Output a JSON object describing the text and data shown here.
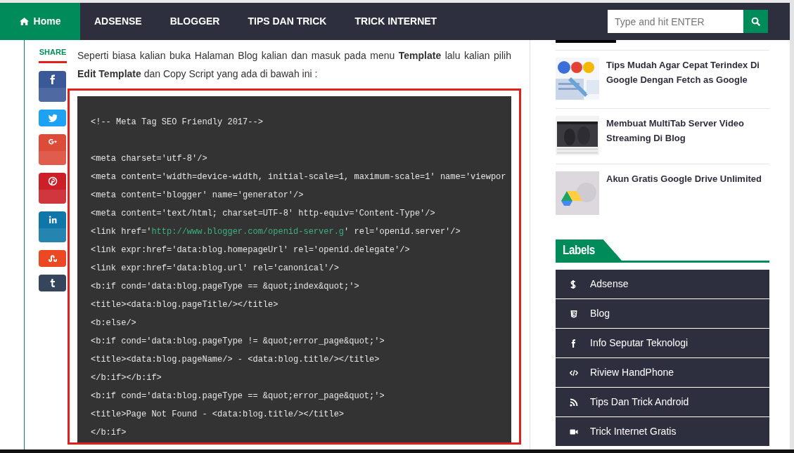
{
  "nav": {
    "items": [
      {
        "label": "Home",
        "selected": true
      },
      {
        "label": "ADSENSE",
        "selected": false
      },
      {
        "label": "BLOGGER",
        "selected": false
      },
      {
        "label": "TIPS DAN TRICK",
        "selected": false
      },
      {
        "label": "TRICK INTERNET",
        "selected": false
      }
    ],
    "search": {
      "placeholder": "Type and hit ENTER"
    }
  },
  "share": {
    "title": "SHARE",
    "buttons": [
      {
        "color": "#3b5998"
      },
      {
        "color": "#1da1f2"
      },
      {
        "color": "#dd4b39"
      },
      {
        "color": "#cb2027"
      },
      {
        "color": "#0e76a8"
      },
      {
        "color": "#eb4924"
      },
      {
        "color": "#35465c"
      }
    ]
  },
  "article": {
    "intro": "Seperti biasa kalian buka Halaman Blog kalian dan masuk pada menu **Template** lalu kalian pilih **Edit Template** dan Copy Script yang ada di bawah ini :",
    "code_lines": [
      {
        "parts": [
          {
            "kind": "plain",
            "text": "<!-- Meta Tag SEO Friendly 2017-->"
          }
        ]
      },
      {
        "parts": [
          {
            "kind": "plain",
            "text": "<meta charset='utf-8'/>"
          }
        ]
      },
      {
        "parts": [
          {
            "kind": "plain",
            "text": "<meta content='width=device-width, initial-scale=1, maximum-scale=1' name='viewpor"
          }
        ]
      },
      {
        "parts": [
          {
            "kind": "plain",
            "text": "<meta content='blogger' name='generator'/>"
          }
        ]
      },
      {
        "parts": [
          {
            "kind": "plain",
            "text": "<meta content='text/html; charset=UTF-8' http-equiv='Content-Type'/>"
          }
        ]
      },
      {
        "parts": [
          {
            "kind": "plain",
            "text": "<link href='"
          },
          {
            "kind": "url",
            "text": "http://www.blogger.com/openid-server.g"
          },
          {
            "kind": "plain",
            "text": "' rel='openid.server'/>"
          }
        ]
      },
      {
        "parts": [
          {
            "kind": "plain",
            "text": "<link expr:href='data:blog.homepageUrl' rel='openid.delegate'/>"
          }
        ]
      },
      {
        "parts": [
          {
            "kind": "plain",
            "text": "<link expr:href='data:blog.url' rel='canonical'/>"
          }
        ]
      },
      {
        "parts": [
          {
            "kind": "plain",
            "text": "<b:if cond='data:blog.pageType == &quot;index&quot;'>"
          }
        ]
      },
      {
        "parts": [
          {
            "kind": "plain",
            "text": "<title><data:blog.pageTitle/></title>"
          }
        ]
      },
      {
        "parts": [
          {
            "kind": "plain",
            "text": "<b:else/>"
          }
        ]
      },
      {
        "parts": [
          {
            "kind": "plain",
            "text": "<b:if cond='data:blog.pageType != &quot;error_page&quot;'>"
          }
        ]
      },
      {
        "parts": [
          {
            "kind": "plain",
            "text": "<title><data:blog.pageName/> - <data:blog.title/></title>"
          }
        ]
      },
      {
        "parts": [
          {
            "kind": "plain",
            "text": "</b:if></b:if>"
          }
        ]
      },
      {
        "parts": [
          {
            "kind": "plain",
            "text": "<b:if cond='data:blog.pageType == &quot;error_page&quot;'>"
          }
        ]
      },
      {
        "parts": [
          {
            "kind": "plain",
            "text": "<title>Page Not Found - <data:blog.title/></title>"
          }
        ]
      },
      {
        "parts": [
          {
            "kind": "plain",
            "text": "</b:if>"
          }
        ]
      }
    ]
  },
  "sidebar": {
    "posts": [
      {
        "title": "Tips Mudah Agar Cepat Terindex Di Google Dengan Fetch as Google"
      },
      {
        "title": "Membuat MultiTab Server Video Streaming Di Blog"
      },
      {
        "title": "Akun Gratis Google Drive Unlimited"
      }
    ],
    "labels": {
      "title": "Labels",
      "items": [
        {
          "label": "Adsense"
        },
        {
          "label": "Blog"
        },
        {
          "label": "Info Seputar Teknologi"
        },
        {
          "label": "Riview HandPhone"
        },
        {
          "label": "Tips Dan Trick Android"
        },
        {
          "label": "Trick Internet Gratis"
        }
      ]
    }
  }
}
